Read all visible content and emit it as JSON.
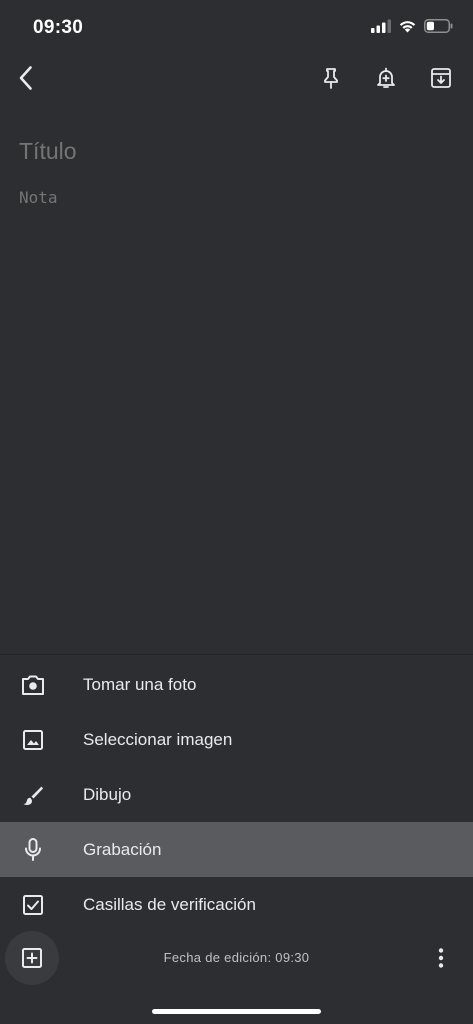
{
  "status_bar": {
    "time": "09:30",
    "icons": [
      "cellular-signal-icon",
      "wifi-icon",
      "battery-icon"
    ]
  },
  "toolbar": {
    "back_icon": "chevron-left-icon",
    "pin_icon": "pin-icon",
    "reminder_icon": "bell-plus-icon",
    "archive_icon": "archive-icon"
  },
  "note": {
    "title_placeholder": "Título",
    "body_placeholder": "Nota"
  },
  "menu": {
    "items": [
      {
        "label": "Tomar una foto",
        "icon": "camera-icon"
      },
      {
        "label": "Seleccionar imagen",
        "icon": "image-icon"
      },
      {
        "label": "Dibujo",
        "icon": "brush-icon"
      },
      {
        "label": "Grabación",
        "icon": "microphone-icon",
        "highlighted": true
      },
      {
        "label": "Casillas de verificación",
        "icon": "checkbox-icon"
      }
    ]
  },
  "footer": {
    "edit_date": "Fecha de edición: 09:30",
    "add_icon": "add-box-icon",
    "more_icon": "more-vertical-icon"
  },
  "colors": {
    "background": "#2d2e31",
    "highlight": "#5a5b5e",
    "text": "#e8eaed",
    "placeholder": "#9aa0a6"
  }
}
